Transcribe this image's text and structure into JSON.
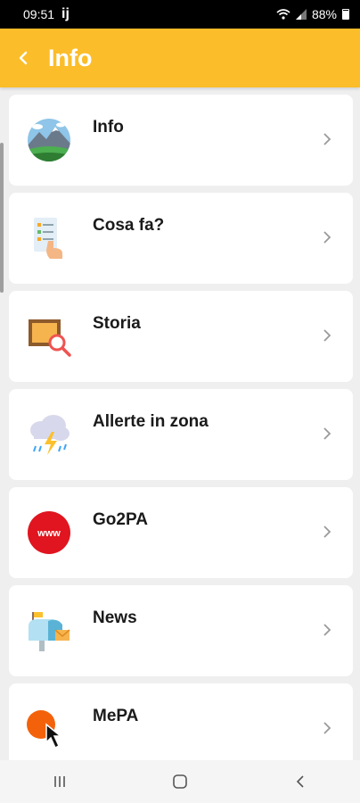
{
  "status": {
    "time": "09:51",
    "app_glyph": "ij",
    "battery": "88%",
    "icons": [
      "wifi-icon",
      "signal-icon",
      "battery-icon"
    ]
  },
  "appbar": {
    "back_icon": "back-arrow-icon",
    "title": "Info",
    "color": "#fbbd29"
  },
  "items": [
    {
      "label": "Info",
      "icon": "landscape-icon"
    },
    {
      "label": "Cosa fa?",
      "icon": "checklist-hand-icon"
    },
    {
      "label": "Storia",
      "icon": "frame-magnifier-icon"
    },
    {
      "label": "Allerte in zona",
      "icon": "storm-cloud-icon"
    },
    {
      "label": "Go2PA",
      "icon": "www-icon",
      "badge": "www"
    },
    {
      "label": "News",
      "icon": "mailbox-icon"
    },
    {
      "label": "MePA",
      "icon": "orange-dot-cursor-icon"
    }
  ],
  "navbar": {
    "icons": [
      "recent-apps-icon",
      "home-icon",
      "back-icon"
    ]
  }
}
